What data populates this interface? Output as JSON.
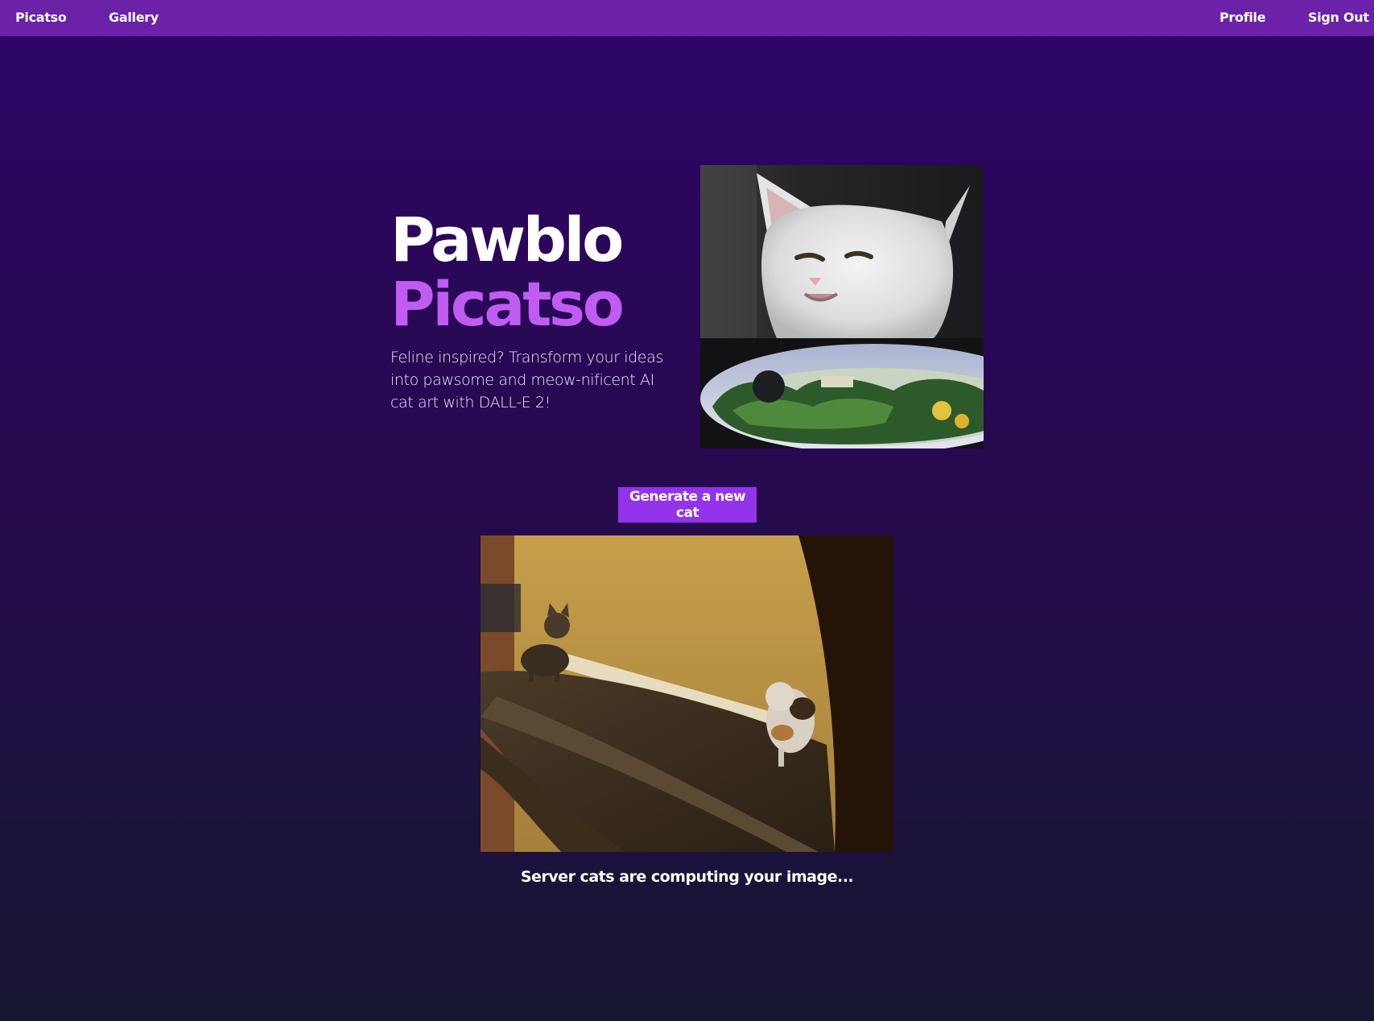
{
  "nav": {
    "brand": "Picatso",
    "gallery": "Gallery",
    "profile": "Profile",
    "sign_out": "Sign Out"
  },
  "hero": {
    "title_line1": "Pawblo",
    "title_line2": "Picatso",
    "tagline": "Feline inspired? Transform your ideas into pawsome and meow-nificent AI cat art with DALL-E 2!"
  },
  "generate": {
    "button_label": "Generate a new cat"
  },
  "status": {
    "message": "Server cats are computing your image..."
  },
  "colors": {
    "nav_bg": "#6b21a8",
    "accent": "#c15cf2",
    "button_bg": "#9333ea"
  }
}
